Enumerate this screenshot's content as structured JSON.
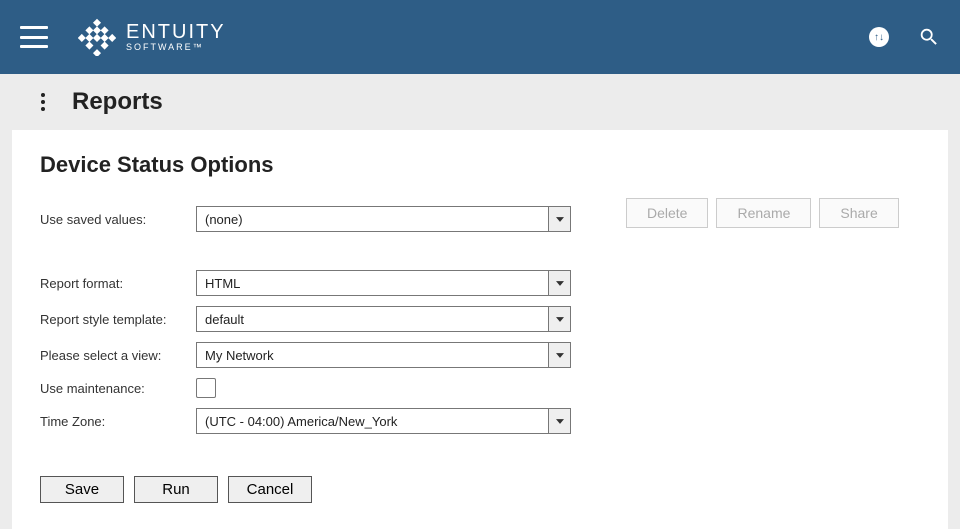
{
  "brand": {
    "name": "ENTUITY",
    "sub": "SOFTWARE™"
  },
  "page": {
    "breadcrumb": "Reports",
    "title": "Device Status Options"
  },
  "fields": {
    "savedValues": {
      "label": "Use saved values:",
      "value": "(none)"
    },
    "format": {
      "label": "Report format:",
      "value": "HTML"
    },
    "template": {
      "label": "Report style template:",
      "value": "default"
    },
    "view": {
      "label": "Please select a view:",
      "value": "My Network"
    },
    "maintenance": {
      "label": "Use maintenance:",
      "checked": false
    },
    "timezone": {
      "label": "Time Zone:",
      "value": "(UTC - 04:00) America/New_York"
    }
  },
  "sideButtons": {
    "delete": "Delete",
    "rename": "Rename",
    "share": "Share"
  },
  "actions": {
    "save": "Save",
    "run": "Run",
    "cancel": "Cancel"
  }
}
